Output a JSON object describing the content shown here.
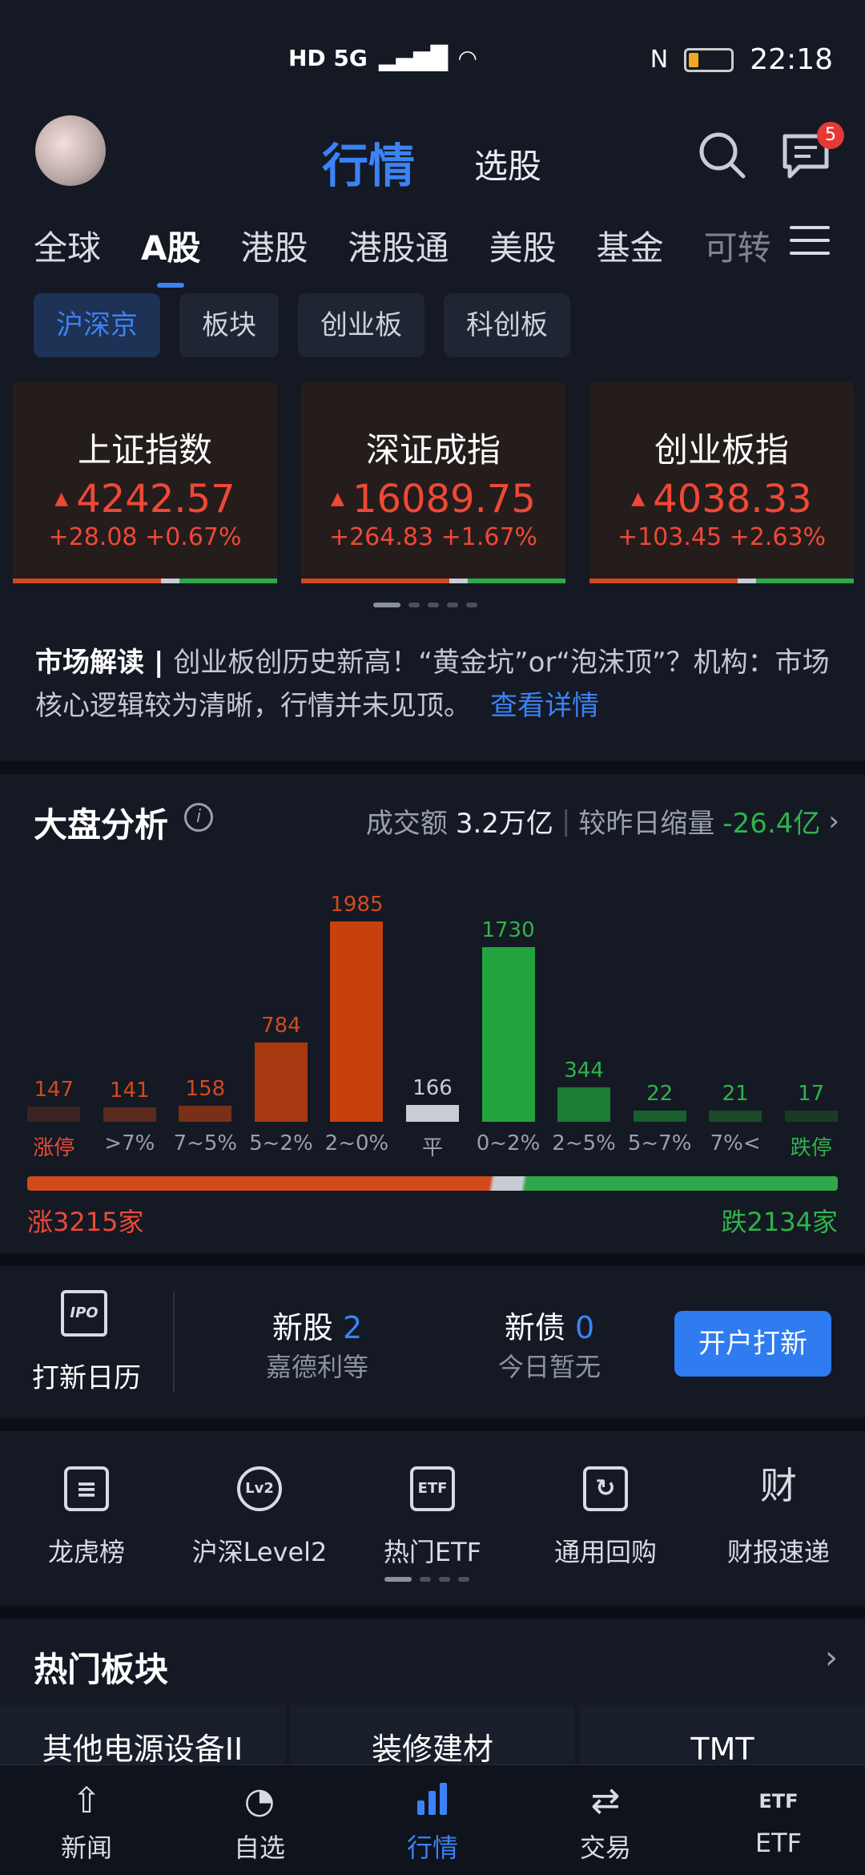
{
  "status_bar": {
    "left_indicators": "HD 5G",
    "time": "22:18"
  },
  "header": {
    "active_tab": "行情",
    "other_tab": "选股",
    "message_badge": "5"
  },
  "market_tabs": [
    "全球",
    "A股",
    "港股",
    "港股通",
    "美股",
    "基金",
    "可转"
  ],
  "chips": [
    "沪深京",
    "板块",
    "创业板",
    "科创板"
  ],
  "indices": [
    {
      "name": "上证指数",
      "value": "4242.57",
      "change": "+28.08 +0.67%"
    },
    {
      "name": "深证成指",
      "value": "16089.75",
      "change": "+264.83 +1.67%"
    },
    {
      "name": "创业板指",
      "value": "4038.33",
      "change": "+103.45 +2.63%"
    }
  ],
  "market_read": {
    "label": "市场解读",
    "text": "创业板创历史新高！“黄金坑”or“泡沫顶”？机构：市场核心逻辑较为清晰，行情并未见顶。",
    "link": "查看详情"
  },
  "analysis": {
    "title": "大盘分析",
    "turnover_label": "成交额",
    "turnover": "3.2万亿",
    "compare_label": "较昨日缩量",
    "compare_value": "-26.4亿",
    "up_count": "涨3215家",
    "down_count": "跌2134家"
  },
  "chart_data": {
    "type": "bar",
    "categories": [
      "涨停",
      ">7%",
      "7~5%",
      "5~2%",
      "2~0%",
      "平",
      "0~2%",
      "2~5%",
      "5~7%",
      "7%<",
      "跌停"
    ],
    "values": [
      147,
      141,
      158,
      784,
      1985,
      166,
      1730,
      344,
      22,
      21,
      17
    ],
    "colors": [
      "#3a2320",
      "#5a2a1c",
      "#7a2f18",
      "#a8380f",
      "#c8400c",
      "#c8ccd4",
      "#23a33e",
      "#1c7d32",
      "#1a5f2b",
      "#1a4a27",
      "#1a3a24"
    ],
    "value_colors": [
      "#d24a1c",
      "#d24a1c",
      "#d24a1c",
      "#d24a1c",
      "#d24a1c",
      "#c8ccd4",
      "#2fb34a",
      "#2fb34a",
      "#2fb34a",
      "#2fb34a",
      "#2fb34a"
    ],
    "label_colors": [
      "#ef4836",
      "#9aa0ac",
      "#9aa0ac",
      "#9aa0ac",
      "#9aa0ac",
      "#9aa0ac",
      "#9aa0ac",
      "#9aa0ac",
      "#9aa0ac",
      "#9aa0ac",
      "#2fb34a"
    ],
    "ylim": [
      0,
      1985
    ]
  },
  "new_issues": {
    "calendar_label": "打新日历",
    "ipo_icon_text": "IPO",
    "new_stock_label": "新股",
    "new_stock_count": "2",
    "new_stock_sub": "嘉德利等",
    "new_bond_label": "新债",
    "new_bond_count": "0",
    "new_bond_sub": "今日暂无",
    "button": "开户打新"
  },
  "tools": [
    {
      "label": "龙虎榜",
      "icon": "list-icon",
      "glyph": "≡"
    },
    {
      "label": "沪深Level2",
      "icon": "lv2-icon",
      "glyph": "Lv2"
    },
    {
      "label": "热门ETF",
      "icon": "etf-icon",
      "glyph": "ETF"
    },
    {
      "label": "通用回购",
      "icon": "repo-icon",
      "glyph": "↻"
    },
    {
      "label": "财报速递",
      "icon": "finance-icon",
      "glyph": "财"
    }
  ],
  "hot_sectors": {
    "title": "热门板块",
    "items": [
      "其他电源设备II",
      "装修建材",
      "TMT"
    ]
  },
  "bottom_nav": [
    {
      "label": "新闻",
      "icon": "news-icon",
      "glyph": "⇧"
    },
    {
      "label": "自选",
      "icon": "watchlist-icon",
      "glyph": "◔"
    },
    {
      "label": "行情",
      "icon": "market-icon",
      "glyph": "▮"
    },
    {
      "label": "交易",
      "icon": "trade-icon",
      "glyph": "⇄"
    },
    {
      "label": "ETF",
      "icon": "etf-nav-icon",
      "glyph": "ETF"
    }
  ]
}
